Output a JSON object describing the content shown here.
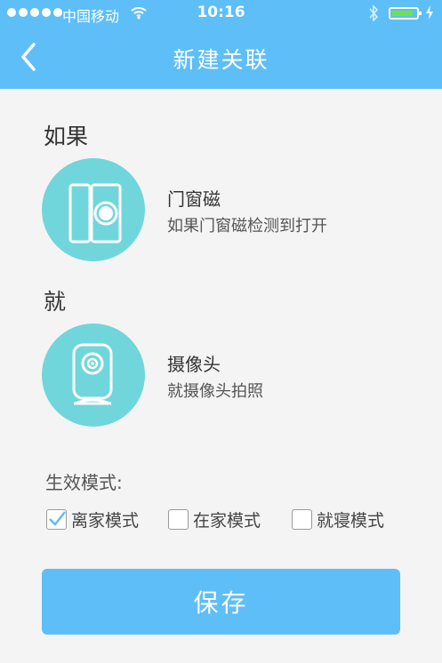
{
  "status_bar": {
    "carrier": "中国移动",
    "time": "10:16"
  },
  "header": {
    "title": "新建关联"
  },
  "if_section": {
    "label": "如果",
    "device_name": "门窗磁",
    "device_desc": "如果门窗磁检测到打开",
    "icon": "door-window-sensor-icon"
  },
  "then_section": {
    "label": "就",
    "device_name": "摄像头",
    "device_desc": "就摄像头拍照",
    "icon": "camera-icon"
  },
  "modes": {
    "label": "生效模式:",
    "options": [
      {
        "label": "离家模式",
        "checked": true
      },
      {
        "label": "在家模式",
        "checked": false
      },
      {
        "label": "就寝模式",
        "checked": false
      }
    ]
  },
  "save_label": "保存",
  "colors": {
    "header": "#5ebef8",
    "icon_circle": "#71d6db",
    "check": "#5ebef8"
  }
}
